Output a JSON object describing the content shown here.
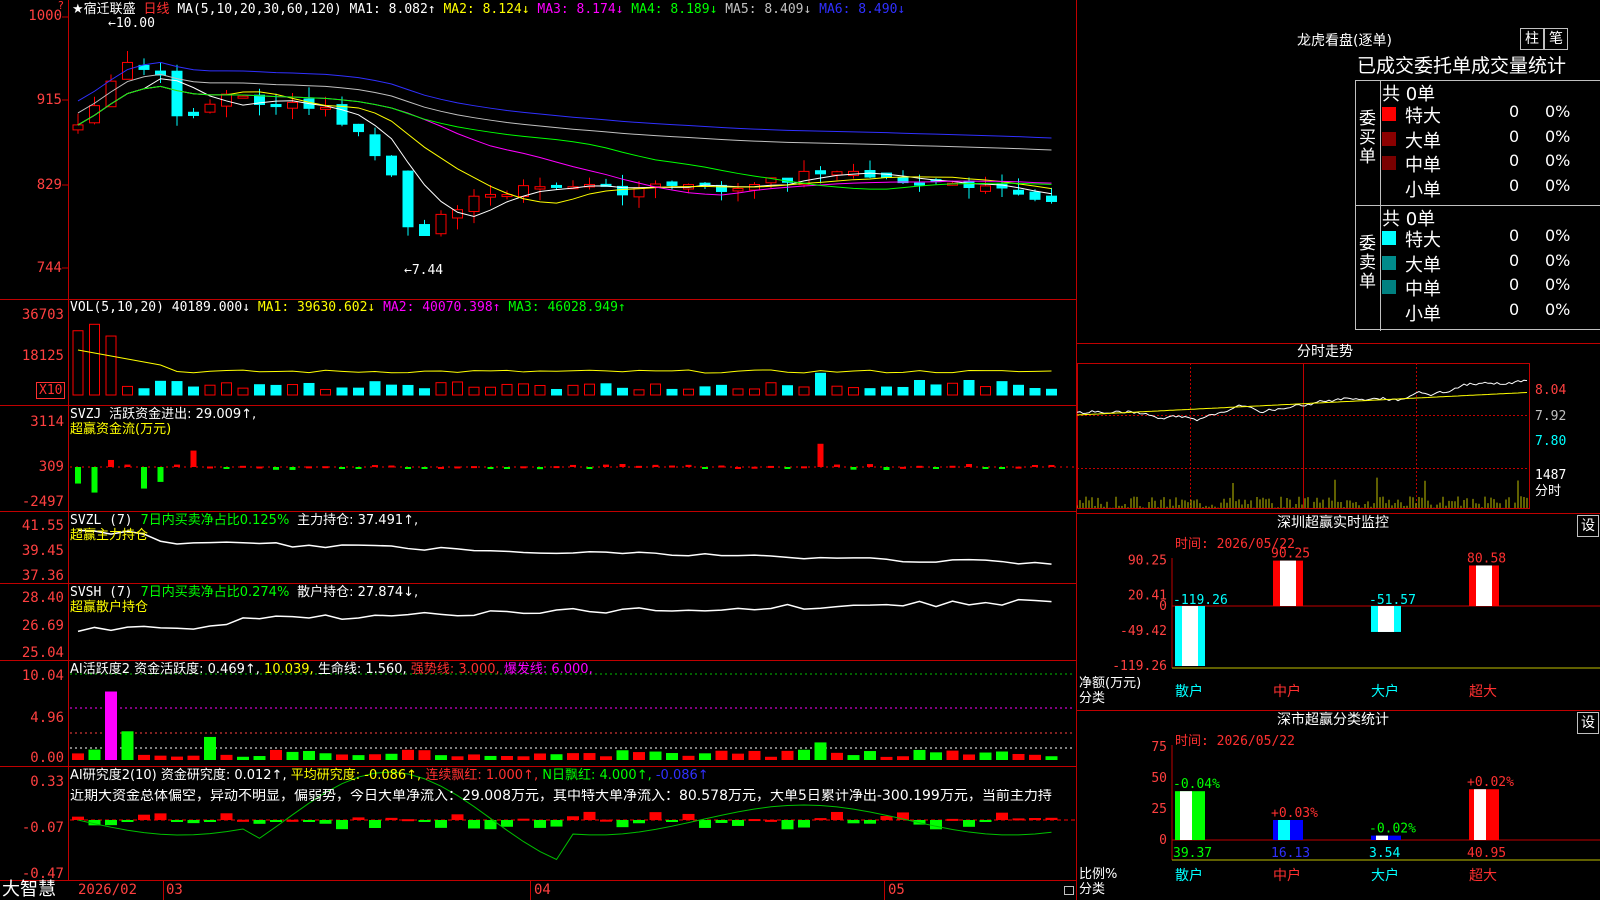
{
  "header": {
    "title": "★宿迁联盛",
    "period": "日线",
    "ma_label": "MA(5,10,20,30,60,120)",
    "ma1": "MA1: 8.082↑",
    "ma2": "MA2: 8.124↓",
    "ma3": "MA3: 8.174↓",
    "ma4": "MA4: 8.189↓",
    "ma5": "MA5: 8.409↓",
    "ma6": "MA6: 8.490↓",
    "high_mark": "10.00",
    "low_mark": "7.44"
  },
  "price_axis": [
    "1000",
    "915",
    "829",
    "744"
  ],
  "vol": {
    "label": "VOL(5,10,20)",
    "value": "40189.000↓",
    "ma1": "MA1: 39630.602↓",
    "ma2": "MA2: 40070.398↑",
    "ma3": "MA3: 46028.949↑",
    "axis": [
      "36703",
      "18125",
      "X10"
    ]
  },
  "svzj": {
    "label": "SVZJ",
    "desc": "活跃资金进出: 29.009↑,",
    "sub": "超赢资金流(万元)",
    "axis": [
      "3114",
      "309",
      "-2497"
    ]
  },
  "svzl": {
    "label": "SVZL (7)",
    "desc1": "7日内买卖净占比0.125%",
    "desc2": "主力持仓: 37.491↑,",
    "sub": "超赢主力持仓",
    "axis": [
      "41.55",
      "39.45",
      "37.36"
    ]
  },
  "svsh": {
    "label": "SVSH (7)",
    "desc1": "7日内买卖净占比0.274%",
    "desc2": "散户持仓: 27.874↓,",
    "sub": "超赢散户持仓",
    "axis": [
      "28.40",
      "26.69",
      "25.04"
    ]
  },
  "ai_active": {
    "label": "AI活跃度2",
    "v1": "资金活跃度: 0.469↑,",
    "v2": "10.039,",
    "v3": "生命线: 1.560,",
    "v4": "强势线: 3.000,",
    "v5": "爆发线: 6.000,",
    "axis": [
      "10.04",
      "4.96",
      "0.00"
    ]
  },
  "ai_research": {
    "label": "AI研究度2(10)",
    "v1": "资金研究度: 0.012↑,",
    "v2": "平均研究度: -0.086↑,",
    "v3": "连续飘红: 1.000↑,",
    "v4": "N日飘红: 4.000↑,",
    "v5": "-0.086↑",
    "commentary": "近期大资金总体偏空，异动不明显，偏弱势，今日大单净流入：29.008万元，其中特大单净流入：80.578万元，大单5日累计净出-300.199万元，当前主力持",
    "axis": [
      "0.33",
      "-0.07",
      "-0.47"
    ]
  },
  "date_axis": {
    "brand": "大智慧",
    "labels": [
      "2026/02",
      "03",
      "04",
      "05"
    ]
  },
  "dragon": {
    "title": "龙虎看盘(逐单)",
    "btn1": "柱",
    "btn2": "笔",
    "tabs": "已成交委托单成交量统计",
    "buy_label": "委买单",
    "sell_label": "委卖单",
    "buy_total": "共 0单",
    "sell_total": "共 0单",
    "buy_rows": [
      {
        "name": "特大",
        "count": "0",
        "pct": "0%",
        "color": "#ff0000"
      },
      {
        "name": "大单",
        "count": "0",
        "pct": "0%",
        "color": "#8b0000"
      },
      {
        "name": "中单",
        "count": "0",
        "pct": "0%",
        "color": "#7a0000"
      },
      {
        "name": "小单",
        "count": "0",
        "pct": "0%",
        "color": "#000000"
      }
    ],
    "sell_rows": [
      {
        "name": "特大",
        "count": "0",
        "pct": "0%",
        "color": "#00ffff"
      },
      {
        "name": "大单",
        "count": "0",
        "pct": "0%",
        "color": "#008b8b"
      },
      {
        "name": "中单",
        "count": "0",
        "pct": "0%",
        "color": "#008080"
      },
      {
        "name": "小单",
        "count": "0",
        "pct": "0%",
        "color": "#000000"
      }
    ]
  },
  "intraday": {
    "title": "分时走势",
    "axis": [
      "8.04",
      "7.92",
      "7.80"
    ],
    "vol_max": "1487",
    "vol_unit": "分时"
  },
  "sz_monitor": {
    "title": "深圳超赢实时监控",
    "btn": "设",
    "time": "时间: 2026/05/22",
    "axis": [
      "90.25",
      "20.41",
      "0",
      "-49.42",
      "-119.26"
    ],
    "ylabel1": "净额(万元)",
    "ylabel2": "分类",
    "categories": [
      "散户",
      "中户",
      "大户",
      "超大"
    ],
    "values": [
      -119.26,
      90.25,
      -51.57,
      80.58
    ],
    "value_labels": [
      "-119.26",
      "90.25",
      "-51.57",
      "80.58"
    ]
  },
  "sz_class": {
    "title": "深市超赢分类统计",
    "btn": "设",
    "time": "时间: 2026/05/22",
    "axis": [
      "75",
      "50",
      "25",
      "0"
    ],
    "ylabel1": "比例%",
    "ylabel2": "分类",
    "categories": [
      "散户",
      "中户",
      "大户",
      "超大"
    ],
    "values": [
      39.37,
      16.13,
      3.54,
      40.95
    ],
    "value_labels": [
      "39.37",
      "16.13",
      "3.54",
      "40.95"
    ],
    "changes": [
      "-0.04%",
      "+0.03%",
      "-0.02%",
      "+0.02%"
    ]
  },
  "colors": {
    "up": "#ff0000",
    "down": "#00ffff",
    "grid": "#c00000",
    "axis_text": "#ff4040"
  }
}
